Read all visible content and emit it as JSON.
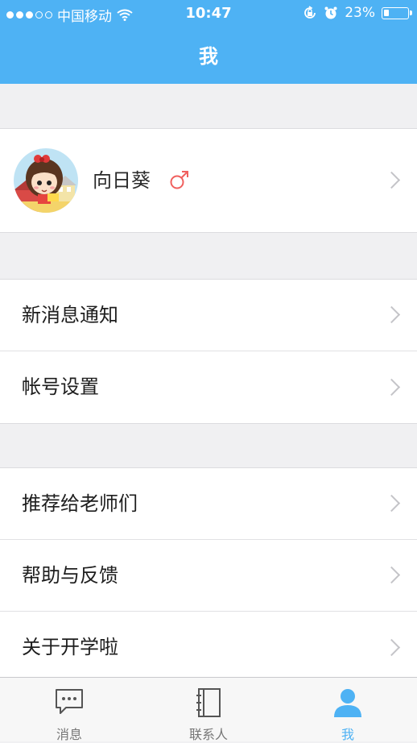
{
  "status_bar": {
    "carrier": "中国移动",
    "time": "10:47",
    "battery": "23%",
    "battery_level": 0.23
  },
  "nav": {
    "title": "我"
  },
  "profile": {
    "name": "向日葵",
    "gender_symbol": "♂"
  },
  "group1": {
    "items": [
      {
        "label": "新消息通知"
      },
      {
        "label": "帐号设置"
      }
    ]
  },
  "group2": {
    "items": [
      {
        "label": "推荐给老师们"
      },
      {
        "label": "帮助与反馈"
      },
      {
        "label": "关于开学啦"
      }
    ]
  },
  "tabbar": {
    "tabs": [
      {
        "label": "消息",
        "icon": "chat-icon"
      },
      {
        "label": "联系人",
        "icon": "contacts-icon"
      },
      {
        "label": "我",
        "icon": "person-icon",
        "active": true
      }
    ]
  },
  "colors": {
    "accent": "#4eb2f4",
    "gender": "#f0605e",
    "chevron": "#c4c4c8"
  }
}
